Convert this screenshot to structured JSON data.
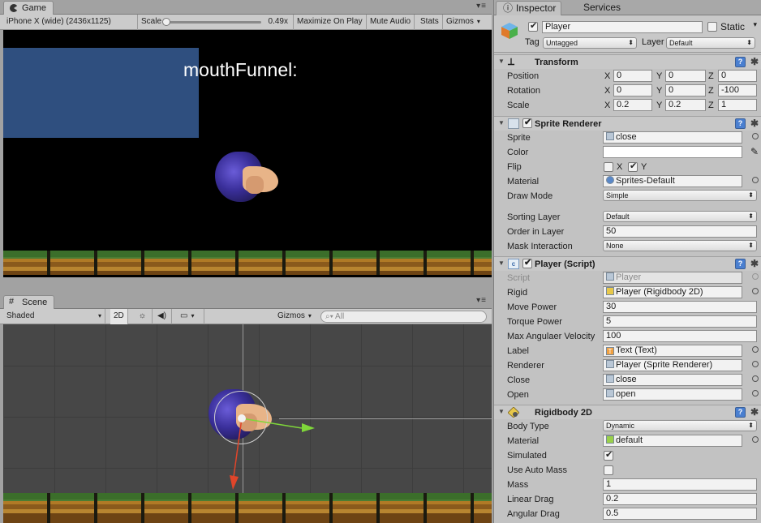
{
  "game": {
    "tab": "Game",
    "resolution": "iPhone X (wide) (2436x1125)",
    "scale_label": "Scale",
    "scale_value": "0.49x",
    "maximize": "Maximize On Play",
    "mute": "Mute Audio",
    "stats": "Stats",
    "gizmos": "Gizmos",
    "label_text": "mouthFunnel:"
  },
  "scene": {
    "tab": "Scene",
    "shading": "Shaded",
    "mode_2d": "2D",
    "gizmos": "Gizmos",
    "search_placeholder": "All"
  },
  "inspector": {
    "tabs": [
      "Inspector",
      "Services"
    ],
    "object_name": "Player",
    "static_label": "Static",
    "tag_label": "Tag",
    "tag_value": "Untagged",
    "layer_label": "Layer",
    "layer_value": "Default",
    "transform": {
      "title": "Transform",
      "position_label": "Position",
      "rotation_label": "Rotation",
      "scale_label": "Scale",
      "axis_x": "X",
      "axis_y": "Y",
      "axis_z": "Z",
      "position": [
        "0",
        "0",
        "0"
      ],
      "rotation": [
        "0",
        "0",
        "-100"
      ],
      "scale": [
        "0.2",
        "0.2",
        "1"
      ]
    },
    "sprite_renderer": {
      "title": "Sprite Renderer",
      "sprite_label": "Sprite",
      "sprite_value": "close",
      "color_label": "Color",
      "flip_label": "Flip",
      "flip_x": "X",
      "flip_y": "Y",
      "material_label": "Material",
      "material_value": "Sprites-Default",
      "draw_mode_label": "Draw Mode",
      "draw_mode_value": "Simple",
      "sorting_layer_label": "Sorting Layer",
      "sorting_layer_value": "Default",
      "order_label": "Order in Layer",
      "order_value": "50",
      "mask_label": "Mask Interaction",
      "mask_value": "None"
    },
    "player_script": {
      "title": "Player (Script)",
      "script_label": "Script",
      "script_value": "Player",
      "rigid_label": "Rigid",
      "rigid_value": "Player (Rigidbody 2D)",
      "move_power_label": "Move Power",
      "move_power_value": "30",
      "torque_power_label": "Torque Power",
      "torque_power_value": "5",
      "max_ang_label": "Max Angulaer Velocity",
      "max_ang_value": "100",
      "label_label": "Label",
      "label_value": "Text (Text)",
      "renderer_label": "Renderer",
      "renderer_value": "Player (Sprite Renderer)",
      "close_label": "Close",
      "close_value": "close",
      "open_label": "Open",
      "open_value": "open"
    },
    "rigidbody": {
      "title": "Rigidbody 2D",
      "body_type_label": "Body Type",
      "body_type_value": "Dynamic",
      "material_label": "Material",
      "material_value": "default",
      "simulated_label": "Simulated",
      "auto_mass_label": "Use Auto Mass",
      "mass_label": "Mass",
      "mass_value": "1",
      "linear_drag_label": "Linear Drag",
      "linear_drag_value": "0.2",
      "angular_drag_label": "Angular Drag",
      "angular_drag_value": "0.5"
    }
  }
}
